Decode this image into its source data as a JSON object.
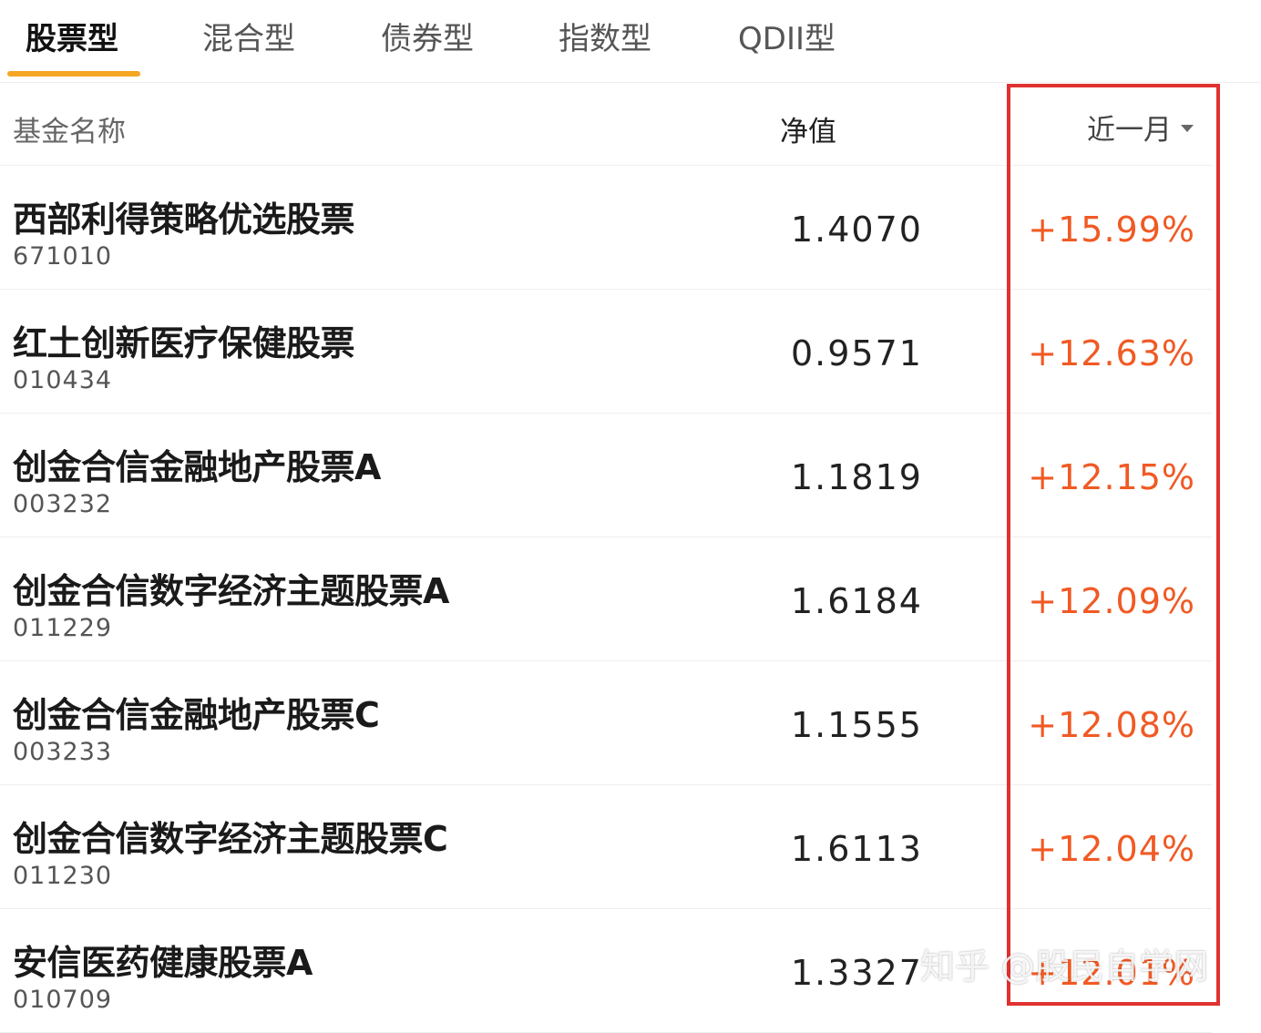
{
  "tabs": [
    {
      "label": "股票型",
      "active": true
    },
    {
      "label": "混合型",
      "active": false
    },
    {
      "label": "债券型",
      "active": false
    },
    {
      "label": "指数型",
      "active": false
    },
    {
      "label": "QDII型",
      "active": false
    }
  ],
  "header": {
    "name_label": "基金名称",
    "nav_label": "净值",
    "period_label": "近一月"
  },
  "funds": [
    {
      "name": "西部利得策略优选股票",
      "code": "671010",
      "nav": "1.4070",
      "change": "+15.99%"
    },
    {
      "name": "红土创新医疗保健股票",
      "code": "010434",
      "nav": "0.9571",
      "change": "+12.63%"
    },
    {
      "name": "创金合信金融地产股票A",
      "code": "003232",
      "nav": "1.1819",
      "change": "+12.15%"
    },
    {
      "name": "创金合信数字经济主题股票A",
      "code": "011229",
      "nav": "1.6184",
      "change": "+12.09%"
    },
    {
      "name": "创金合信金融地产股票C",
      "code": "003233",
      "nav": "1.1555",
      "change": "+12.08%"
    },
    {
      "name": "创金合信数字经济主题股票C",
      "code": "011230",
      "nav": "1.6113",
      "change": "+12.04%"
    },
    {
      "name": "安信医药健康股票A",
      "code": "010709",
      "nav": "1.3327",
      "change": "+12.01%"
    }
  ],
  "watermark": "知乎 @股民自学网",
  "colors": {
    "accent_underline": "#f5a623",
    "gain": "#f05a24",
    "highlight_border": "#e03131"
  }
}
